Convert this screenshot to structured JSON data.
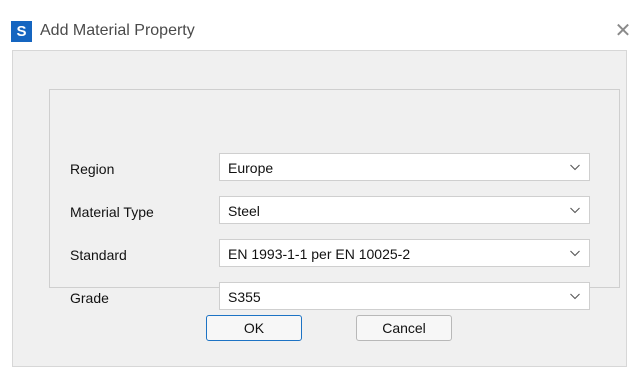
{
  "window": {
    "app_icon_letter": "S",
    "title": "Add Material Property",
    "close_symbol": "✕"
  },
  "fields": [
    {
      "label": "Region",
      "value": "Europe"
    },
    {
      "label": "Material Type",
      "value": "Steel"
    },
    {
      "label": "Standard",
      "value": "EN 1993-1-1 per EN 10025-2"
    },
    {
      "label": "Grade",
      "value": "S355"
    }
  ],
  "buttons": {
    "ok_label": "OK",
    "cancel_label": "Cancel"
  },
  "colors": {
    "accent": "#1d73c4",
    "app_icon": "#1565c0",
    "panel_bg": "#f0f0f0"
  },
  "icons": {
    "dropdown": "chevron-down-icon",
    "close": "close-icon",
    "app": "app-logo-icon"
  }
}
